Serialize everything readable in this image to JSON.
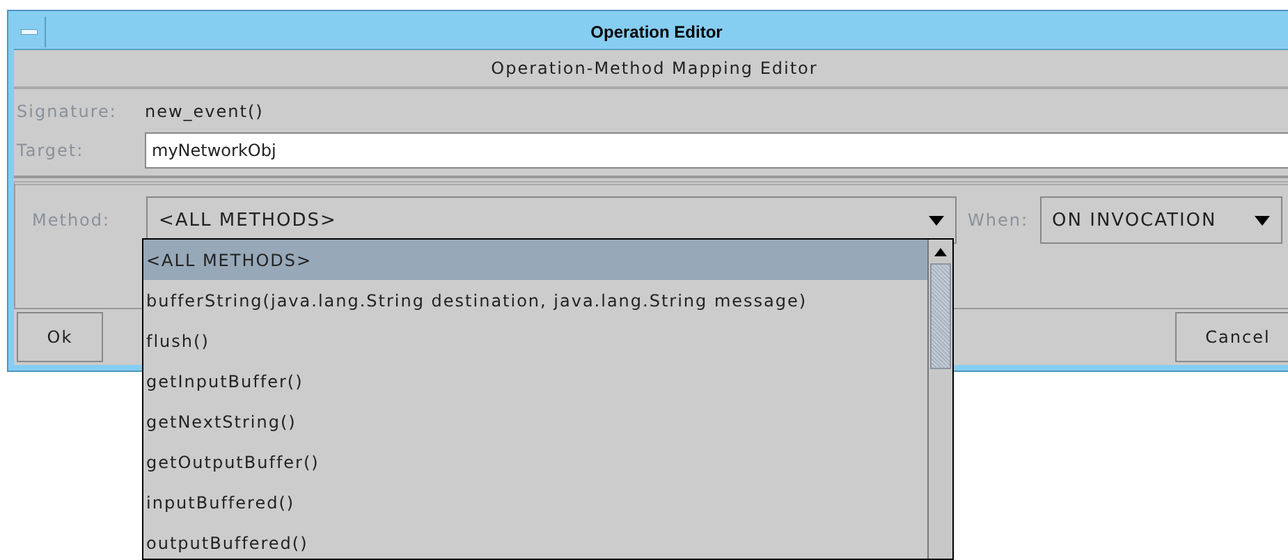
{
  "window": {
    "title": "Operation Editor"
  },
  "header": "Operation-Method Mapping Editor",
  "signature": {
    "label": "Signature:",
    "value": "new_event()"
  },
  "target": {
    "label": "Target:",
    "value": "myNetworkObj"
  },
  "method": {
    "label": "Method:",
    "value": "<ALL METHODS>",
    "expanded": true
  },
  "when": {
    "label": "When:",
    "value": "ON INVOCATION"
  },
  "buttons": [
    "Ok",
    "Cancel"
  ],
  "method_options": [
    {
      "label": "<ALL METHODS>",
      "selected": true
    },
    {
      "label": "bufferString(java.lang.String destination, java.lang.String message)",
      "selected": false
    },
    {
      "label": "flush()",
      "selected": false
    },
    {
      "label": "getInputBuffer()",
      "selected": false
    },
    {
      "label": "getNextString()",
      "selected": false
    },
    {
      "label": "getOutputBuffer()",
      "selected": false
    },
    {
      "label": "inputBuffered()",
      "selected": false
    },
    {
      "label": "outputBuffered()",
      "selected": false
    }
  ]
}
